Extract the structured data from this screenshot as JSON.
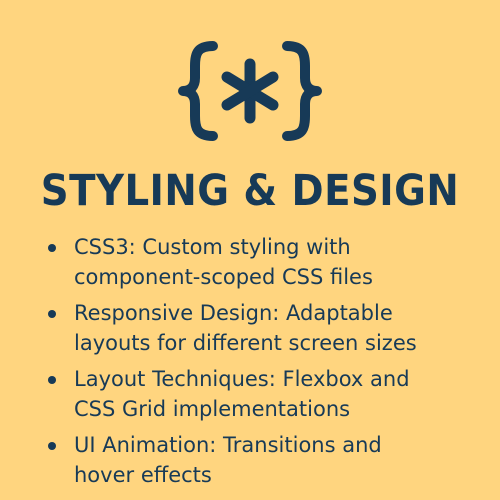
{
  "logo": {
    "icon": "curly-braces-asterisk-icon",
    "color": "#173A57"
  },
  "title": "STYLING & DESIGN",
  "features": [
    {
      "line1": "CSS3: Custom styling with",
      "line2": "component-scoped CSS files"
    },
    {
      "line1": "Responsive Design: Adaptable",
      "line2": "layouts for different screen sizes"
    },
    {
      "line1": "Layout Techniques: Flexbox and",
      "line2": "CSS Grid implementations"
    },
    {
      "line1": "UI Animation: Transitions and",
      "line2": "hover effects"
    }
  ],
  "colors": {
    "background": "#FFD57F",
    "text": "#173A57"
  }
}
